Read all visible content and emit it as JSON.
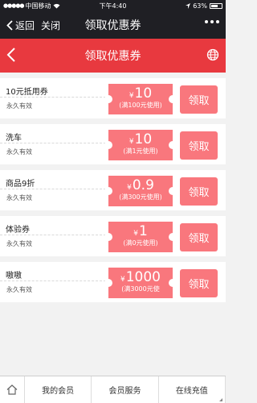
{
  "status_bar": {
    "carrier": "中国移动",
    "time": "下午4:40",
    "battery": "63%"
  },
  "wechat_bar": {
    "back_label": "返回",
    "close_label": "关闭",
    "title": "领取优惠券"
  },
  "header": {
    "title": "领取优惠券"
  },
  "coupons": [
    {
      "name": "10元抵用券",
      "validity": "永久有效",
      "currency": "¥",
      "amount": "10",
      "condition": "(满100元使用)",
      "claim_label": "领取"
    },
    {
      "name": "洗车",
      "validity": "永久有效",
      "currency": "¥",
      "amount": "10",
      "condition": "(满1元使用)",
      "claim_label": "领取"
    },
    {
      "name": "商品9折",
      "validity": "永久有效",
      "currency": "¥",
      "amount": "0.9",
      "condition": "(满300元使用)",
      "claim_label": "领取"
    },
    {
      "name": "体验券",
      "validity": "永久有效",
      "currency": "¥",
      "amount": "1",
      "condition": "(满0元使用)",
      "claim_label": "领取"
    },
    {
      "name": "嗷嗷",
      "validity": "永久有效",
      "currency": "¥",
      "amount": "1000",
      "condition": "(满3000元使",
      "claim_label": "领取"
    }
  ],
  "bottom_nav": {
    "items": [
      "我的会员",
      "会员服务",
      "在线充值"
    ]
  },
  "colors": {
    "header_red": "#e8393f",
    "ticket_pink": "#f9777d",
    "dark_bar": "#1f1f24"
  }
}
